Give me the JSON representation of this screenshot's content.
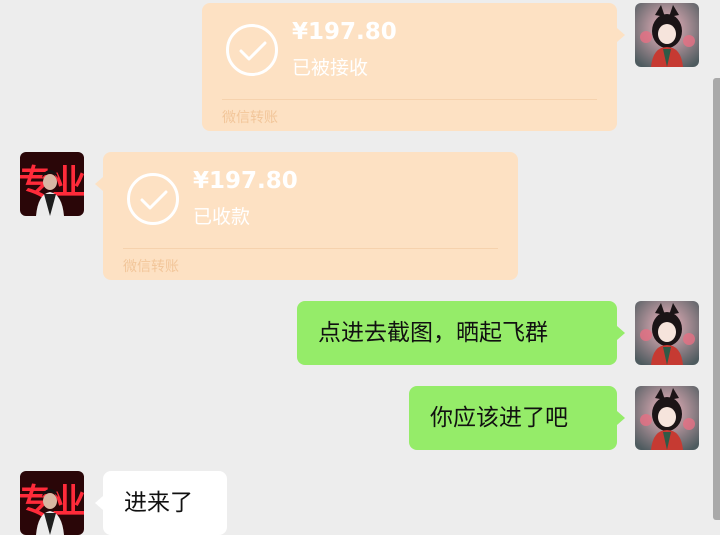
{
  "messages": [
    {
      "side": "right",
      "type": "transfer",
      "amount": "¥197.80",
      "status": "已被接收",
      "footer": "微信转账"
    },
    {
      "side": "left",
      "type": "transfer",
      "amount": "¥197.80",
      "status": "已收款",
      "footer": "微信转账"
    },
    {
      "side": "right",
      "type": "text",
      "text": "点进去截图，晒起飞群"
    },
    {
      "side": "right",
      "type": "text",
      "text": "你应该进了吧"
    },
    {
      "side": "left",
      "type": "text",
      "text": "进来了"
    }
  ],
  "avatars": {
    "self": "anime-girl-avatar",
    "contact": "专业"
  },
  "colors": {
    "background": "#ededed",
    "transfer_card": "#fde1c3",
    "self_bubble": "#95ec69",
    "other_bubble": "#ffffff"
  }
}
